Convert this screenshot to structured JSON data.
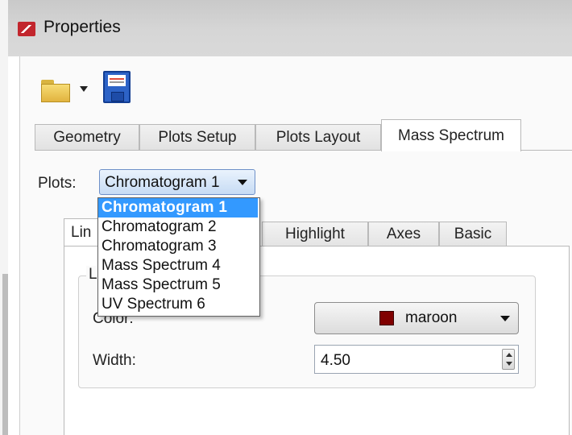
{
  "window": {
    "title": "Properties"
  },
  "toolbar": {
    "open_icon": "folder-icon",
    "save_icon": "floppy-disk-icon"
  },
  "tabs": [
    {
      "label": "Geometry"
    },
    {
      "label": "Plots Setup"
    },
    {
      "label": "Plots Layout"
    },
    {
      "label": "Mass Spectrum",
      "active": true
    }
  ],
  "plots": {
    "label": "Plots:",
    "selected": "Chromatogram 1",
    "options": [
      "Chromatogram 1",
      "Chromatogram 2",
      "Chromatogram 3",
      "Mass Spectrum 4",
      "Mass Spectrum 5",
      "UV Spectrum 6"
    ]
  },
  "subtabs": [
    {
      "label": "Lin"
    },
    {
      "label": "Highlight"
    },
    {
      "label": "Axes"
    },
    {
      "label": "Basic"
    }
  ],
  "line_group": {
    "title": "L",
    "color_label": "Color:",
    "color_value": "maroon",
    "color_hex": "#800000",
    "width_label": "Width:",
    "width_value": "4.50"
  }
}
